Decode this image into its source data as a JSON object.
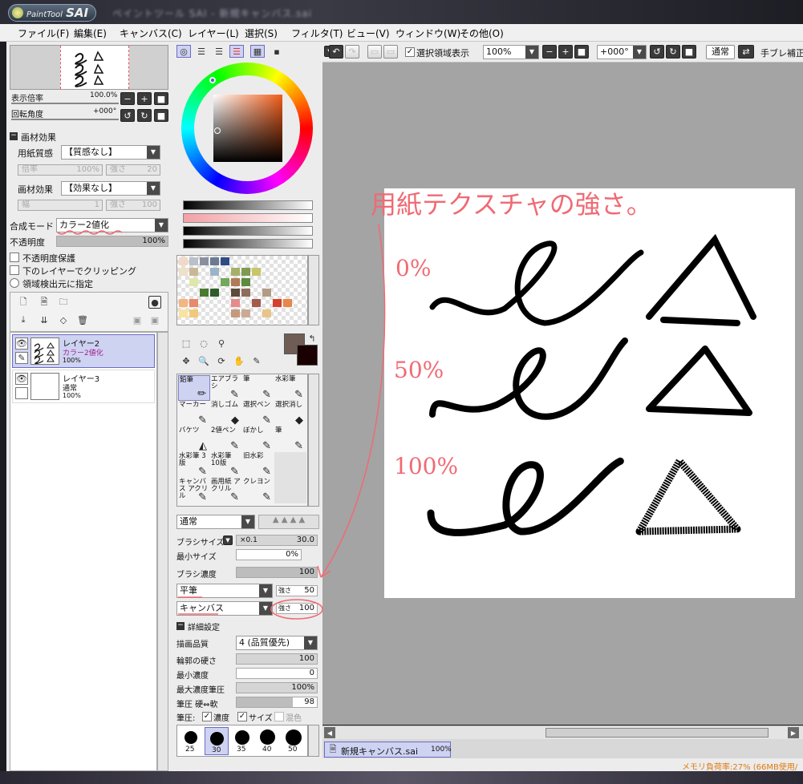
{
  "app": {
    "logo_small": "PaintTool",
    "logo_big": "SAI",
    "window_title": "ペイントツール SAI - 新規キャンバス.sai"
  },
  "menu": [
    "ファイル(F)",
    "編集(E)",
    "キャンバス(C)",
    "レイヤー(L)",
    "選択(S)",
    "フィルタ(T)",
    "ビュー(V)",
    "ウィンドウ(W)",
    "その他(O)"
  ],
  "navigator": {
    "zoom_label": "表示倍率",
    "zoom_value": "100.0%",
    "rotate_label": "回転角度",
    "rotate_value": "+000°"
  },
  "texture": {
    "section": "画材効果",
    "paper_label": "用紙質感",
    "paper_value": "【質感なし】",
    "paper_scale_label": "倍率",
    "paper_scale_value": "100%",
    "paper_strength_label": "強さ",
    "paper_strength_value": "20",
    "effect_label": "画材効果",
    "effect_value": "【効果なし】",
    "effect_width_label": "幅",
    "effect_width_value": "1",
    "effect_strength_label": "強さ",
    "effect_strength_value": "100"
  },
  "layer_props": {
    "blend_label": "合成モード",
    "blend_value": "カラー2値化",
    "opacity_label": "不透明度",
    "opacity_value": "100%",
    "opacity_level": 1.0,
    "lock_alpha": "不透明度保護",
    "clip": "下のレイヤーでクリッピング",
    "region_source": "領域検出元に指定"
  },
  "layers": [
    {
      "name": "レイヤー2",
      "mode": "カラー2値化",
      "opacity": "100%",
      "selected": true
    },
    {
      "name": "レイヤー3",
      "mode": "通常",
      "opacity": "100%",
      "selected": false
    }
  ],
  "tools": [
    {
      "name": "鉛筆",
      "selected": true
    },
    {
      "name": "エアブラシ"
    },
    {
      "name": "筆"
    },
    {
      "name": "水彩筆"
    },
    {
      "name": "マーカー"
    },
    {
      "name": "消しゴム"
    },
    {
      "name": "選択ペン"
    },
    {
      "name": "選択消し"
    },
    {
      "name": "バケツ"
    },
    {
      "name": "2値ペン"
    },
    {
      "name": "ぼかし"
    },
    {
      "name": "筆"
    },
    {
      "name": "水彩筆 3版"
    },
    {
      "name": "水彩筆 10版"
    },
    {
      "name": "旧水彩"
    },
    {
      "name": ""
    },
    {
      "name": "キャンバス アクリル"
    },
    {
      "name": "画用紙 アクリル"
    },
    {
      "name": "クレヨン"
    },
    {
      "name": ""
    }
  ],
  "brush": {
    "blend_mode": "通常",
    "size_label": "ブラシサイズ",
    "size_mult": "×0.1",
    "size_value": "30.0",
    "min_size_label": "最小サイズ",
    "min_size_value": "0%",
    "density_label": "ブラシ濃度",
    "density_value": "100",
    "density_level": 1.0,
    "shape_value": "平筆",
    "shape_strength_label": "強さ",
    "shape_strength_value": "50",
    "texture_value": "キャンバス",
    "texture_strength_label": "強さ",
    "texture_strength_value": "100",
    "advanced_label": "詳細設定",
    "quality_label": "描画品質",
    "quality_value": "4 (品質優先)",
    "hardness_label": "輪郭の硬さ",
    "hardness_value": "100",
    "min_density_label": "最小濃度",
    "min_density_value": "0",
    "max_pressure_label": "最大濃度筆圧",
    "max_pressure_value": "100%",
    "pressure_label": "筆圧 硬⇔軟",
    "pressure_value": "98",
    "pressure_opts_label": "筆圧:",
    "opt_density": "濃度",
    "opt_size": "サイズ",
    "opt_mix": "混色"
  },
  "brush_sizes": [
    "25",
    "30",
    "35",
    "40",
    "50"
  ],
  "toolbar": {
    "show_selection": "選択領域表示",
    "zoom": "100%",
    "angle": "+000°",
    "mode": "通常",
    "stabilizer": "手ブレ補正"
  },
  "canvas_annotations": {
    "title": "用紙テクスチャの強さ。",
    "p0": "0%",
    "p50": "50%",
    "p100": "100%"
  },
  "doc_tab": {
    "name": "新規キャンバス.sai",
    "zoom": "100%"
  },
  "status": "メモリ負荷率:27% (66MB使用/",
  "colors": {
    "accent": "#f06a74",
    "selected_layer": "#cfd3f2",
    "canvas_bg": "#a4a4a4"
  }
}
